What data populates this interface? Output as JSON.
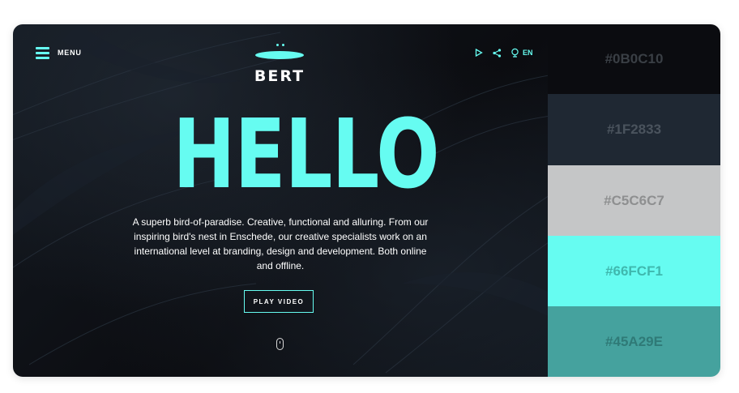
{
  "nav": {
    "menu_label": "MENU",
    "lang_label": "EN"
  },
  "icons": [
    "menu-icon",
    "play-icon",
    "share-icon",
    "globe-icon",
    "scroll-mouse-icon"
  ],
  "logo": {
    "name": "BERT"
  },
  "hero": {
    "headline": "HELLO",
    "description": "A superb bird-of-paradise. Creative, functional and alluring. From our inspiring bird's nest in Enschede, our creative specialists work on an international level at branding, design and development. Both online and offline.",
    "button_label": "PLAY VIDEO"
  },
  "colors": {
    "accent": "#66FCF1",
    "background": "#0B0C10"
  },
  "palette": [
    {
      "hex": "#0B0C10",
      "label": "#0B0C10",
      "text_color": "#3a3f45"
    },
    {
      "hex": "#1F2833",
      "label": "#1F2833",
      "text_color": "#4a535d"
    },
    {
      "hex": "#C5C6C7",
      "label": "#C5C6C7",
      "text_color": "#8e8f90"
    },
    {
      "hex": "#66FCF1",
      "label": "#66FCF1",
      "text_color": "#3fb8ae"
    },
    {
      "hex": "#45A29E",
      "label": "#45A29E",
      "text_color": "#2f7a77"
    }
  ]
}
